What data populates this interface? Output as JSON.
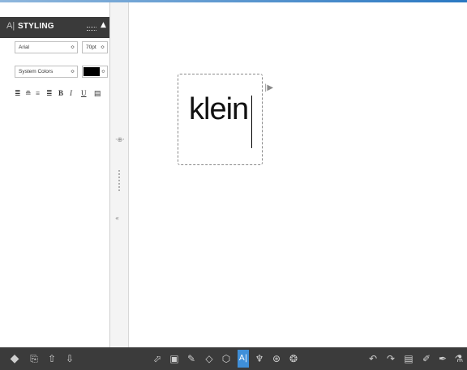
{
  "panel": {
    "title_icon": "A|",
    "title": "STYLING",
    "collapse_icon": "▲",
    "font_family": "Arial",
    "font_size": "70pt",
    "color_scheme": "System Colors",
    "text_color": "#000000",
    "format_buttons": [
      "align-left-icon",
      "align-center-icon",
      "align-right-icon",
      "align-justify-icon",
      "B",
      "I",
      "U",
      "text-box-icon"
    ]
  },
  "canvas": {
    "text": "klein"
  },
  "toolbar": {
    "left_icons": [
      "layers-icon",
      "copy-icon",
      "move-up-icon",
      "move-down-icon"
    ],
    "center_icons": [
      "select-icon",
      "rectangle-icon",
      "pencil-icon",
      "shape-icon",
      "polygon-icon",
      "text-icon",
      "brush-icon",
      "compass-icon",
      "pattern-icon"
    ],
    "right_icons": [
      "undo-icon",
      "redo-icon",
      "image-icon",
      "eraser-icon",
      "pen-icon",
      "paint-icon"
    ],
    "active_label": "A|"
  },
  "colors": {
    "panel_header": "#3a3a3a",
    "toolbar_bg": "#3b3b3b",
    "active_tool": "#3f8fd8"
  }
}
